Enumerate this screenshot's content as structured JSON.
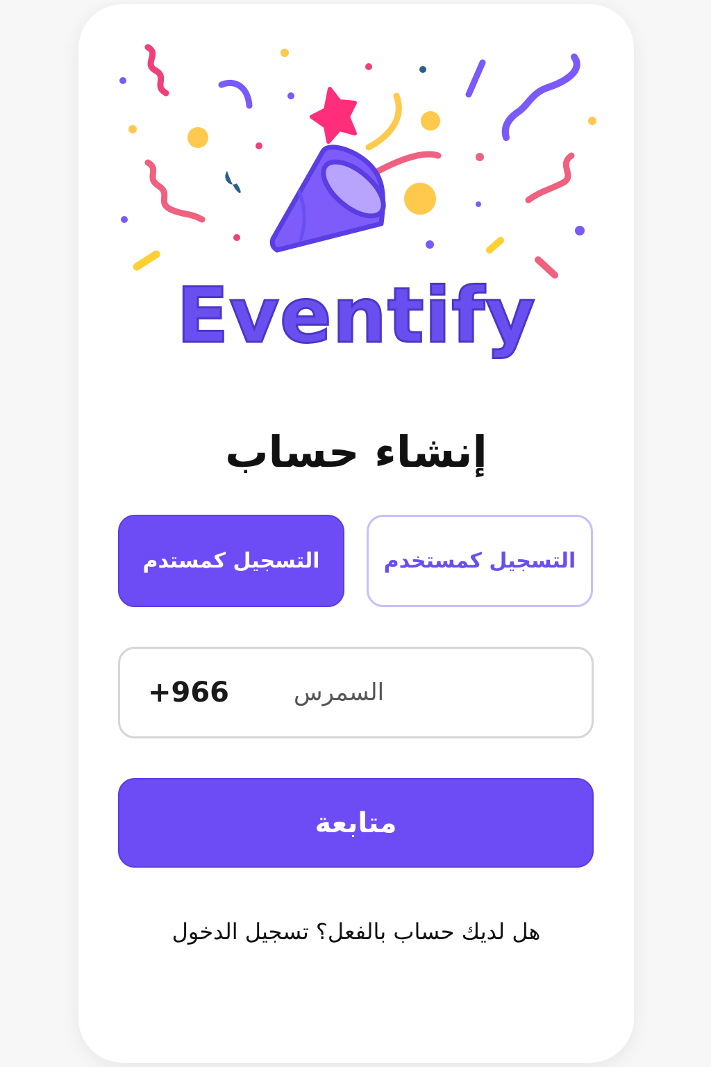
{
  "brand": {
    "name": "Eventify",
    "illustration": "party-popper-confetti-icon",
    "colors": {
      "primary": "#6d4cf6",
      "pink": "#ff3d7f",
      "coral": "#f0607f",
      "yellow": "#ffc94d",
      "navy": "#2e5f8c"
    }
  },
  "form": {
    "title": "إنشاء حساب",
    "role_user_label": "التسجيل كمستخدم",
    "role_organizer_label": "التسجيل كمستدم",
    "phone": {
      "country_code": "+966",
      "placeholder": "السمرس"
    },
    "continue_label": "متابعة"
  },
  "footer": {
    "question": "هل لديك حساب بالفعل؟",
    "login_link": "تسجيل الدخول"
  }
}
